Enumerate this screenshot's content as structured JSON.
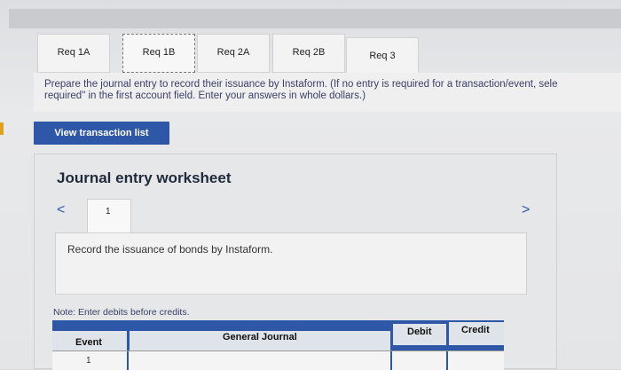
{
  "tabs": [
    {
      "label": "Req 1A"
    },
    {
      "label": "Req 1B"
    },
    {
      "label": "Req 2A"
    },
    {
      "label": "Req 2B"
    },
    {
      "label": "Req 3"
    }
  ],
  "instructions": {
    "line1": "Prepare the journal entry to record their issuance by Instaform. (If no entry is required for a transaction/event, sele",
    "line2": "required\" in the first account field. Enter your answers in whole dollars.)"
  },
  "view_button": "View transaction list",
  "worksheet": {
    "title": "Journal entry worksheet",
    "nav_prev": "<",
    "nav_next": ">",
    "page": "1",
    "record_text": "Record the issuance of bonds by Instaform.",
    "note": "Note: Enter debits before credits."
  },
  "table": {
    "headers": {
      "event": "Event",
      "general_journal": "General Journal",
      "debit": "Debit",
      "credit": "Credit"
    },
    "rows": [
      {
        "event": "1"
      }
    ]
  },
  "colors": {
    "accent": "#2f57a8"
  }
}
